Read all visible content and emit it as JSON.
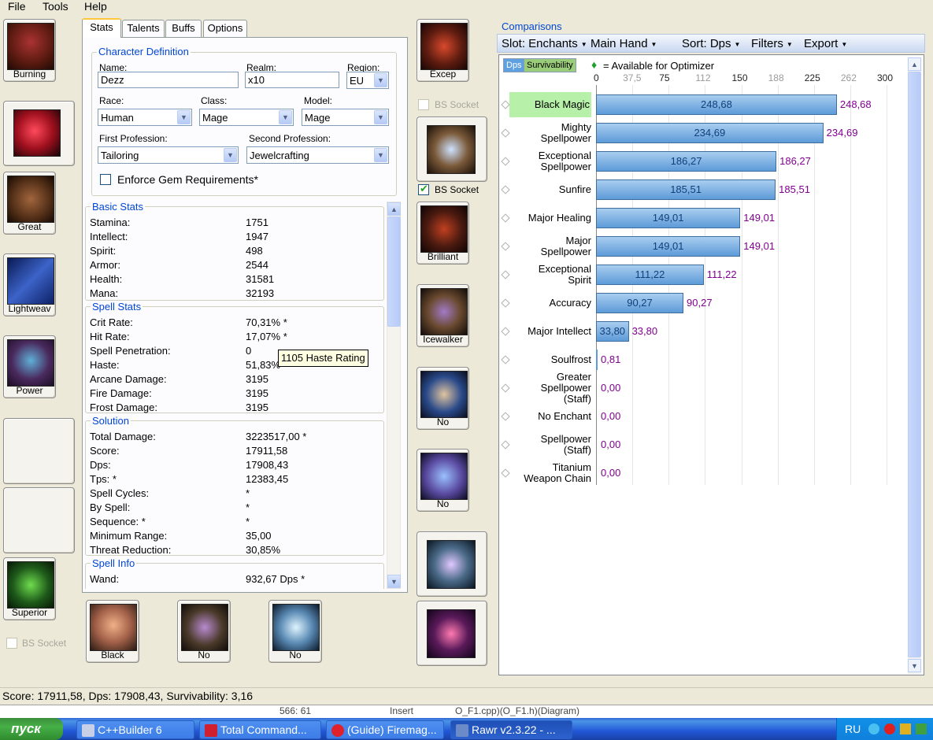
{
  "menu": [
    "File",
    "Tools",
    "Help"
  ],
  "tabs": [
    "Stats",
    "Talents",
    "Buffs",
    "Options"
  ],
  "char_def": {
    "title": "Character Definition",
    "name_label": "Name:",
    "name": "Dezz",
    "realm_label": "Realm:",
    "realm": "x10",
    "region_label": "Region:",
    "region": "EU",
    "race_label": "Race:",
    "race": "Human",
    "class_label": "Class:",
    "class": "Mage",
    "model_label": "Model:",
    "model": "Mage",
    "prof1_label": "First Profession:",
    "prof1": "Tailoring",
    "prof2_label": "Second Profession:",
    "prof2": "Jewelcrafting",
    "enforce_label": "Enforce Gem Requirements*"
  },
  "basic_stats": {
    "title": "Basic Stats",
    "rows": [
      [
        "Stamina:",
        "1751"
      ],
      [
        "Intellect:",
        "1947"
      ],
      [
        "Spirit:",
        "498"
      ],
      [
        "Armor:",
        "2544"
      ],
      [
        "Health:",
        "31581"
      ],
      [
        "Mana:",
        "32193"
      ]
    ]
  },
  "spell_stats": {
    "title": "Spell Stats",
    "rows": [
      [
        "Crit Rate:",
        "70,31% *"
      ],
      [
        "Hit Rate:",
        "17,07% *"
      ],
      [
        "Spell Penetration:",
        "0"
      ],
      [
        "Haste:",
        "51,83%"
      ],
      [
        "Arcane Damage:",
        "3195"
      ],
      [
        "Fire Damage:",
        "3195"
      ],
      [
        "Frost Damage:",
        "3195"
      ]
    ]
  },
  "solution": {
    "title": "Solution",
    "rows": [
      [
        "Total Damage:",
        "3223517,00 *"
      ],
      [
        "Score:",
        "17911,58"
      ],
      [
        "Dps:",
        "17908,43"
      ],
      [
        "Tps: *",
        "12383,45"
      ],
      [
        "Spell Cycles:",
        "*"
      ],
      [
        "By Spell:",
        "*"
      ],
      [
        "Sequence: *",
        "*"
      ],
      [
        "Minimum Range:",
        "35,00"
      ],
      [
        "Threat Reduction:",
        "30,85%"
      ]
    ]
  },
  "spell_info": {
    "title": "Spell Info",
    "rows": [
      [
        "Wand:",
        "932,67 Dps *"
      ]
    ]
  },
  "tooltip": "1105 Haste Rating",
  "gear_labels": {
    "head": "Burning",
    "shoulder": "Great",
    "back": "Lightweav",
    "chest": "Power",
    "legs": "Superior",
    "hands": "Excep",
    "waist": "Brilliant",
    "feet": "Icewalker",
    "ring1": "No",
    "ring2": "No",
    "mainhand": "Black",
    "offhand": "No",
    "ranged": "No"
  },
  "bs_socket": "BS Socket",
  "comparisons": {
    "title": "Comparisons",
    "toolbar": [
      "Slot: Enchants",
      "Main Hand",
      "Sort: Dps",
      "Filters",
      "Export"
    ],
    "legend_dps": "Dps",
    "legend_surv": "Survivability",
    "legend_available": "= Available for Optimizer",
    "colors": {
      "bar": "#5d9bd8",
      "value": "#80008f",
      "highlight": "#b7f0a8"
    }
  },
  "chart_data": {
    "type": "bar",
    "orientation": "horizontal",
    "x_ticks": [
      "0",
      "37,5",
      "75",
      "112",
      "150",
      "188",
      "225",
      "262",
      "300"
    ],
    "xlim": [
      0,
      300
    ],
    "categories": [
      "Black Magic",
      "Mighty Spellpower",
      "Exceptional Spellpower",
      "Sunfire",
      "Major Healing",
      "Major Spellpower",
      "Exceptional Spirit",
      "Accuracy",
      "Major Intellect",
      "Soulfrost",
      "Greater Spellpower (Staff)",
      "No Enchant",
      "Spellpower (Staff)",
      "Titanium Weapon Chain"
    ],
    "values": [
      248.68,
      234.69,
      186.27,
      185.51,
      149.01,
      149.01,
      111.22,
      90.27,
      33.8,
      0.81,
      0.0,
      0.0,
      0.0,
      0.0
    ],
    "labels": [
      "248,68",
      "234,69",
      "186,27",
      "185,51",
      "149,01",
      "149,01",
      "111,22",
      "90,27",
      "33,80",
      "0,81",
      "0,00",
      "0,00",
      "0,00",
      "0,00"
    ]
  },
  "status": "Score: 17911,58, Dps: 17908,43, Survivability: 3,16",
  "taskbar": {
    "start": "пуск",
    "tasks": [
      "C++Builder 6",
      "Total Command...",
      "(Guide) Firemag...",
      "Rawr v2.3.22 - ..."
    ],
    "lang": "RU"
  },
  "behind_window_text": [
    "566: 61",
    "Insert",
    "O_F1.cpp)(O_F1.h)(Diagram)"
  ]
}
